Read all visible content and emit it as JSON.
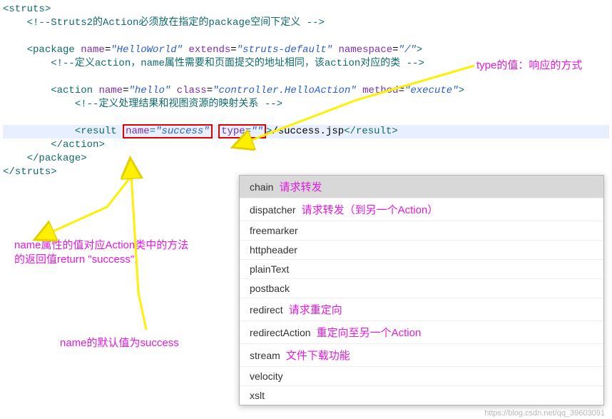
{
  "code": {
    "l1_open": "<",
    "l1_tag": "struts",
    "l1_close": ">",
    "l2_open": "<!--",
    "l2_text": "Struts2的Action必须放在指定的package空间下定义 ",
    "l2_close": "-->",
    "l3_open": "<",
    "l3_tag": "package",
    "l3_a1": " name",
    "l3_eq": "=",
    "l3_v1": "\"HelloWorld\"",
    "l3_a2": " extends",
    "l3_v2": "\"struts-default\"",
    "l3_a3": " namespace",
    "l3_v3": "\"/\"",
    "l3_close": ">",
    "l4_open": "<!--",
    "l4_text": "定义action，name属性需要和页面提交的地址相同，该action对应的类 ",
    "l4_close": "-->",
    "l5_open": "<",
    "l5_tag": "action",
    "l5_a1": " name",
    "l5_v1": "\"hello\"",
    "l5_a2": " class",
    "l5_v2": "\"controller.HelloAction\"",
    "l5_a3": " method",
    "l5_v3": "\"execute\"",
    "l5_close": ">",
    "l6_open": "<!--",
    "l6_text": "定义处理结果和视图资源的映射关系 ",
    "l6_close": "-->",
    "l7_open": "<",
    "l7_tag": "result",
    "l7_sp": " ",
    "l7_a1": "name",
    "l7_v1": "=\"success\"",
    "l7_a2": "type",
    "l7_v2": "=\"",
    "l7_v2b": "\"",
    "l7_mid": ">",
    "l7_text": "/success.jsp",
    "l7_ctag_open": "</",
    "l7_ctag": "result",
    "l7_cclose": ">",
    "l8_open": "</",
    "l8_tag": "action",
    "l8_close": ">",
    "l9_open": "</",
    "l9_tag": "package",
    "l9_close": ">",
    "l10_open": "</",
    "l10_tag": "struts",
    "l10_close": ">"
  },
  "anno": {
    "type_note": "type的值：响应的方式",
    "name_note_l1": "name属性的值对应Action类中的方法",
    "name_note_l2": "的返回值return \"success\";",
    "name_default": "name的默认值为success"
  },
  "popup": {
    "items": [
      {
        "opt": "chain",
        "hint": "请求转发"
      },
      {
        "opt": "dispatcher",
        "hint": "请求转发（到另一个Action）"
      },
      {
        "opt": "freemarker",
        "hint": ""
      },
      {
        "opt": "httpheader",
        "hint": ""
      },
      {
        "opt": "plainText",
        "hint": ""
      },
      {
        "opt": "postback",
        "hint": ""
      },
      {
        "opt": "redirect",
        "hint": "请求重定向"
      },
      {
        "opt": "redirectAction",
        "hint": "重定向至另一个Action"
      },
      {
        "opt": "stream",
        "hint": "文件下载功能"
      },
      {
        "opt": "velocity",
        "hint": ""
      },
      {
        "opt": "xslt",
        "hint": ""
      }
    ]
  },
  "watermark": "https://blog.csdn.net/qq_39603091"
}
